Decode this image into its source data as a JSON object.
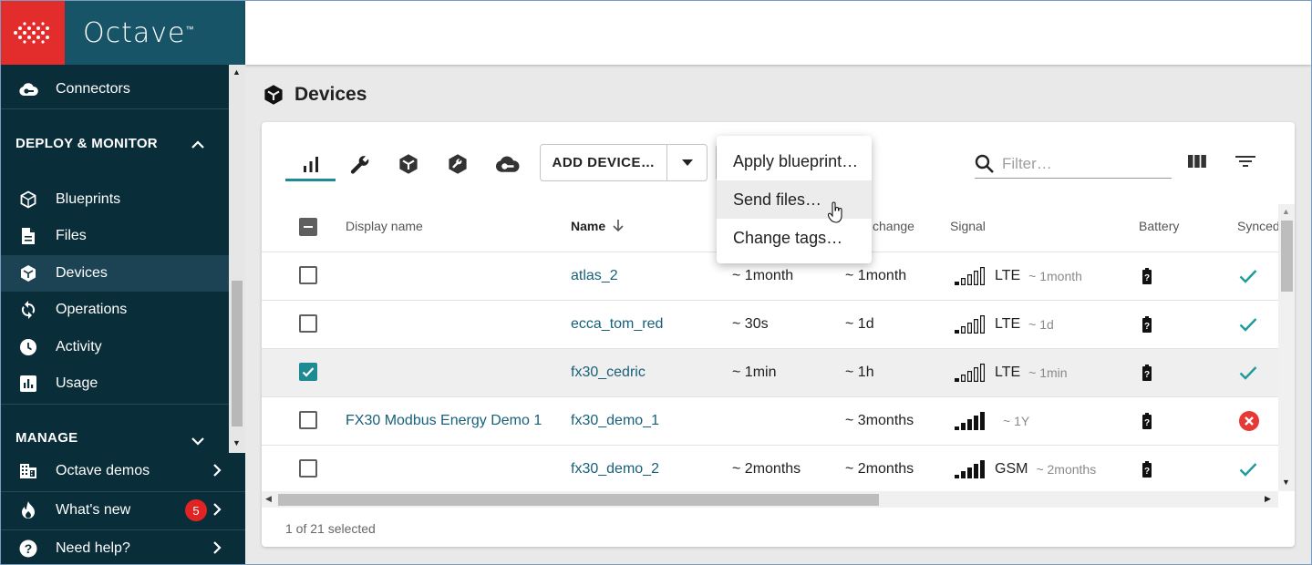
{
  "brand": {
    "name": "Octave",
    "tm": "™",
    "accent_red": "#e32d2d",
    "header_color": "#175468",
    "sidebar_color": "#0a2d3a",
    "teal": "#1d8a94"
  },
  "sidebar": {
    "top_item": {
      "label": "Connectors",
      "icon": "cloud-connector-icon"
    },
    "deploy_section": "DEPLOY & MONITOR",
    "items": [
      {
        "label": "Blueprints",
        "icon": "hexagon-outline-icon"
      },
      {
        "label": "Files",
        "icon": "file-icon"
      },
      {
        "label": "Devices",
        "icon": "cube-icon",
        "active": true
      },
      {
        "label": "Operations",
        "icon": "sync-icon"
      },
      {
        "label": "Activity",
        "icon": "clock-icon"
      },
      {
        "label": "Usage",
        "icon": "bar-chart-icon"
      }
    ],
    "manage_section": "MANAGE",
    "bottom": [
      {
        "label": "Octave demos",
        "icon": "building-icon"
      },
      {
        "label": "What's new",
        "icon": "fire-icon",
        "badge": "5"
      },
      {
        "label": "Need help?",
        "icon": "help-icon"
      }
    ]
  },
  "page": {
    "title": "Devices"
  },
  "toolbar": {
    "add_device_label": "ADD DEVICE…",
    "filter_placeholder": "Filter…"
  },
  "menu": {
    "items": [
      "Apply blueprint…",
      "Send files…",
      "Change tags…"
    ],
    "hovered": "Send files…"
  },
  "table": {
    "headers": {
      "display_name": "Display name",
      "name": "Name",
      "last_change": "change",
      "signal": "Signal",
      "battery": "Battery",
      "synced": "Synced"
    },
    "rows": [
      {
        "checked": false,
        "display_name": "",
        "name": "atlas_2",
        "last_seen": "~ 1month",
        "last_change": "~ 1month",
        "network": "LTE",
        "signal_time": "~ 1month",
        "signal_bars": 1,
        "synced": "ok"
      },
      {
        "checked": false,
        "display_name": "",
        "name": "ecca_tom_red",
        "last_seen": "~ 30s",
        "last_change": "~ 1d",
        "network": "LTE",
        "signal_time": "~ 1d",
        "signal_bars": 1,
        "synced": "ok"
      },
      {
        "checked": true,
        "display_name": "",
        "name": "fx30_cedric",
        "last_seen": "~ 1min",
        "last_change": "~ 1h",
        "network": "LTE",
        "signal_time": "~ 1min",
        "signal_bars": 1,
        "synced": "ok"
      },
      {
        "checked": false,
        "display_name": "FX30 Modbus Energy Demo 1",
        "name": "fx30_demo_1",
        "last_seen": "",
        "last_change": "~ 3months",
        "network": "",
        "signal_time": "~ 1Y",
        "signal_bars": 5,
        "synced": "error"
      },
      {
        "checked": false,
        "display_name": "",
        "name": "fx30_demo_2",
        "last_seen": "~ 2months",
        "last_change": "~ 2months",
        "network": "GSM",
        "signal_time": "~ 2months",
        "signal_bars": 5,
        "synced": "ok"
      }
    ],
    "footer": "1 of 21 selected"
  }
}
